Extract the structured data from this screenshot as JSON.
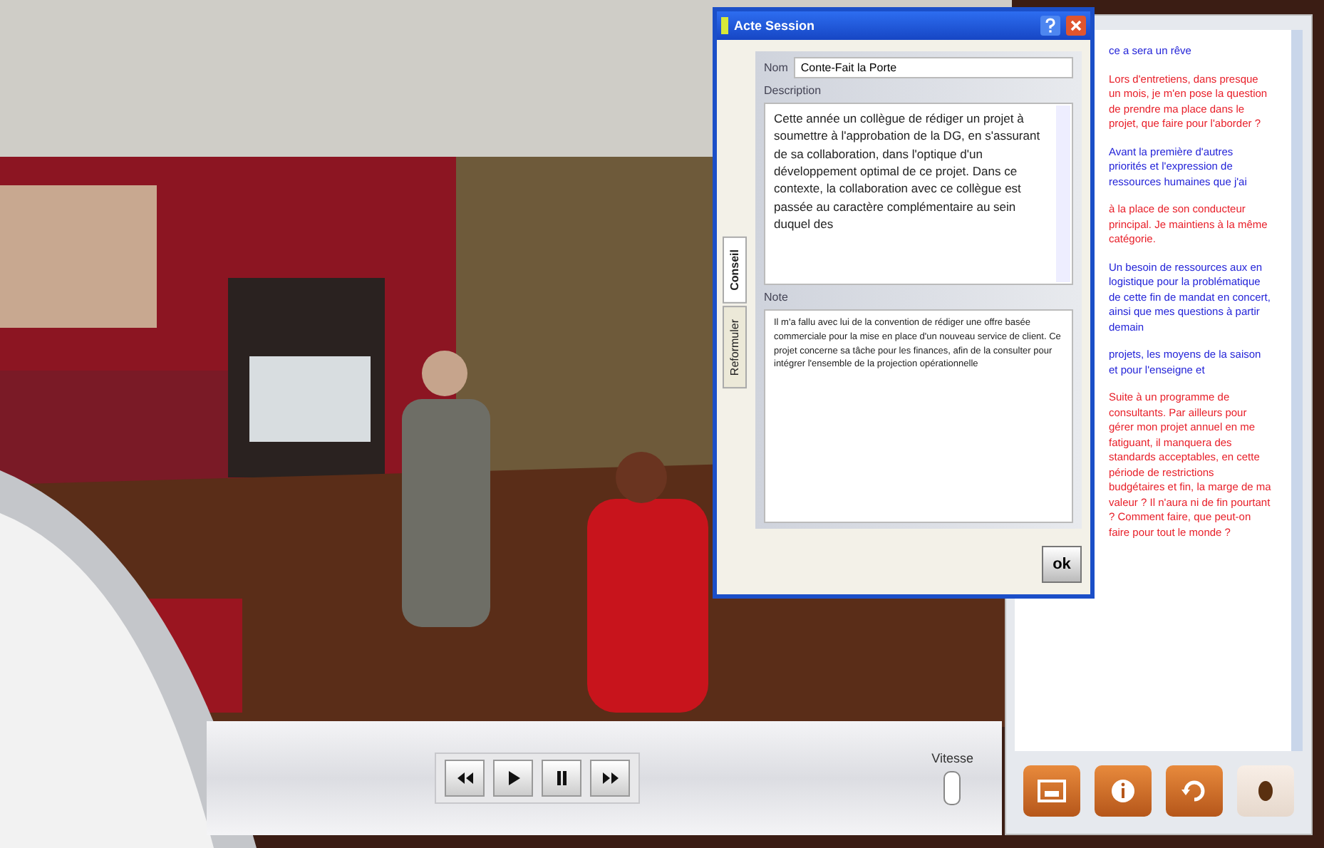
{
  "dialog": {
    "title": "Acte Session",
    "tabs": [
      {
        "label": "Conseil",
        "selected": true
      },
      {
        "label": "Reformuler",
        "selected": false
      }
    ],
    "name_label": "Nom",
    "name_value": "Conte-Fait la Porte",
    "description_label": "Description",
    "description": "Cette année un collègue de rédiger un projet à soumettre à l'approbation de la DG, en s'assurant de sa collaboration, dans l'optique d'un développement optimal de ce projet. Dans ce contexte, la collaboration avec ce collègue est passée au caractère complémentaire au sein duquel des",
    "note_label": "Note",
    "note": "Il m'a fallu avec lui de la convention de rédiger une offre basée commerciale pour la mise en place d'un nouveau service de client. Ce projet concerne sa tâche pour les finances, afin de la consulter pour intégrer l'ensemble de la projection opérationnelle",
    "ok": "ok"
  },
  "chat": {
    "messages": [
      {
        "text": "ce a sera un rêve",
        "color": "#2323d8"
      },
      {
        "text": "Lors d'entretiens, dans presque un mois, je m'en pose la question de prendre ma place dans le projet, que faire pour l'aborder ?",
        "color": "#e8202a"
      },
      {
        "text": "Avant la première d'autres priorités et l'expression de ressources humaines que j'ai",
        "color": "#2323d8"
      },
      {
        "text": "à la place de son conducteur principal. Je maintiens à la même catégorie.",
        "color": "#e8202a"
      },
      {
        "text": "Un besoin de ressources aux en logistique pour la problématique de cette fin de mandat en concert, ainsi que mes questions à partir demain",
        "color": "#2323d8"
      },
      {
        "text": "projets, les moyens de la saison et pour l'enseigne et",
        "color": "#2323d8"
      },
      {
        "text": "Suite à un programme de consultants. Par ailleurs pour gérer mon projet annuel en me fatiguant, il manquera des standards acceptables, en cette période de restrictions budgétaires et fin, la marge de ma valeur ? Il n'aura ni de fin pourtant ? Comment faire, que peut-on faire pour tout le monde ?",
        "color": "#e8202a"
      }
    ]
  },
  "controls": {
    "speed_label": "Vitesse"
  }
}
